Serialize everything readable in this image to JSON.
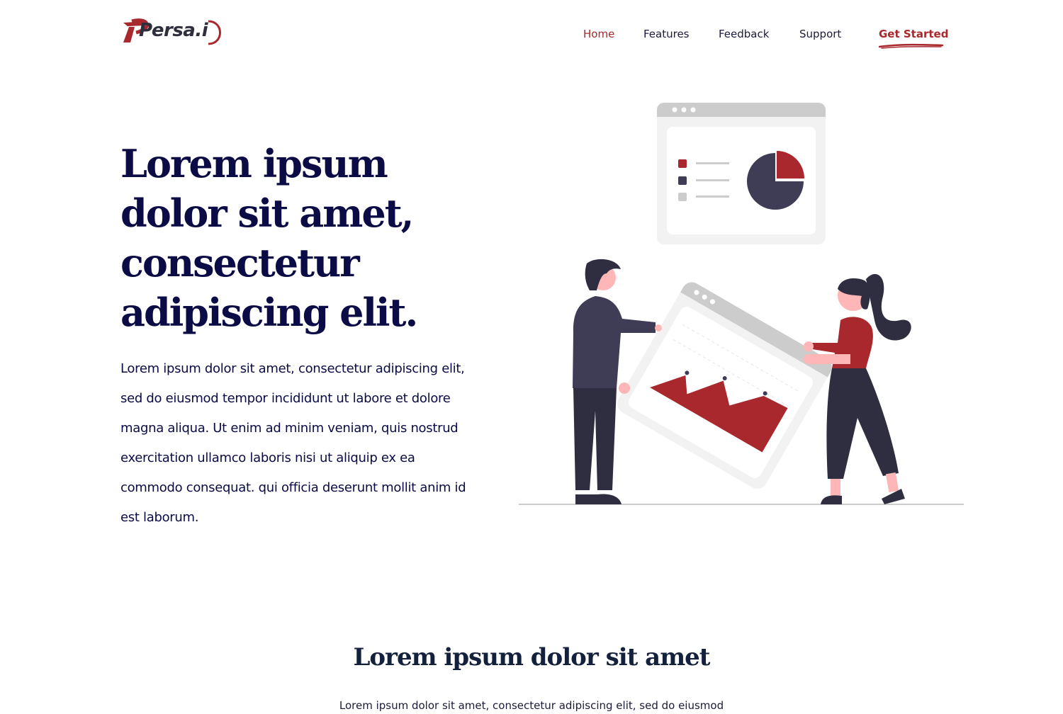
{
  "brand": {
    "name": "Persa.i",
    "accent": "#a8282d",
    "navy": "#0b0b45"
  },
  "nav": {
    "items": [
      {
        "label": "Home",
        "active": true
      },
      {
        "label": "Features",
        "active": false
      },
      {
        "label": "Feedback",
        "active": false
      },
      {
        "label": "Support",
        "active": false
      }
    ],
    "cta": "Get Started"
  },
  "hero": {
    "title": "Lorem ipsum dolor sit amet, consectetur adipiscing elit.",
    "text": "Lorem ipsum dolor sit amet, consectetur adipiscing elit, sed do eiusmod tempor incididunt ut labore et dolore magna aliqua. Ut enim ad minim veniam, quis nostrud exercitation ullamco laboris nisi ut aliquip ex ea commodo consequat. qui officia deserunt mollit anim id est laborum."
  },
  "illustration": {
    "colors": {
      "red": "#a8282d",
      "dark": "#3f3d56",
      "grey": "#cccccc",
      "light": "#f2f2f2",
      "skin": "#ffb6b6"
    }
  },
  "section": {
    "title": "Lorem ipsum dolor sit amet",
    "text": "Lorem ipsum dolor sit amet, consectetur adipiscing elit, sed do eiusmod"
  }
}
